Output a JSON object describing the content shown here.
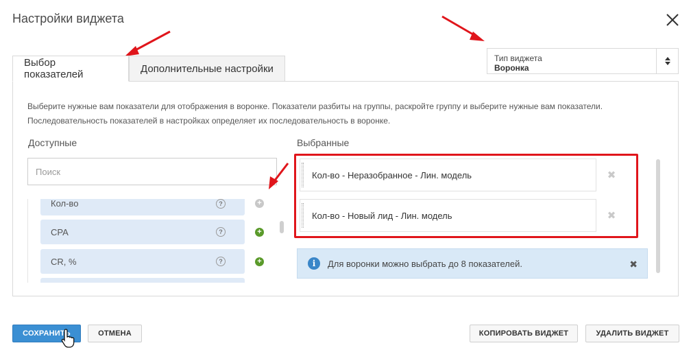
{
  "dialog": {
    "title": "Настройки виджета"
  },
  "widget_type": {
    "label": "Тип виджета",
    "value": "Воронка"
  },
  "tabs": [
    {
      "label": "Выбор показателей",
      "active": true
    },
    {
      "label": "Дополнительные настройки",
      "active": false
    }
  ],
  "description": "Выберите нужные вам показатели для отображения в воронке. Показатели разбиты на группы, раскройте группу и выберите нужные вам показатели. Последовательность показателей в настройках определяет их последовательность в воронке.",
  "available": {
    "heading": "Доступные",
    "search_placeholder": "Поиск",
    "items": [
      {
        "label": "Кол-во",
        "help": "?"
      },
      {
        "label": "CPA",
        "help": "?"
      },
      {
        "label": "CR, %",
        "help": "?"
      }
    ]
  },
  "selected": {
    "heading": "Выбранные",
    "items": [
      {
        "label": "Кол-во - Неразобранное - Лин. модель"
      },
      {
        "label": "Кол-во - Новый лид - Лин. модель"
      }
    ]
  },
  "info": {
    "text": "Для воронки можно выбрать до 8 показателей."
  },
  "buttons": {
    "save": "Сохранить",
    "cancel": "Отмена",
    "copy": "Копировать виджет",
    "delete": "Удалить виджет"
  },
  "colors": {
    "accent": "#3b8fd3",
    "highlight_red": "#e0151b",
    "item_bg": "#dfeaf7",
    "add_green": "#5a9a2a"
  },
  "icons": [
    "close-icon",
    "sort-arrows-icon",
    "help-icon",
    "add-icon",
    "remove-icon",
    "info-icon",
    "drag-handle-icon",
    "pointer-cursor-icon"
  ]
}
